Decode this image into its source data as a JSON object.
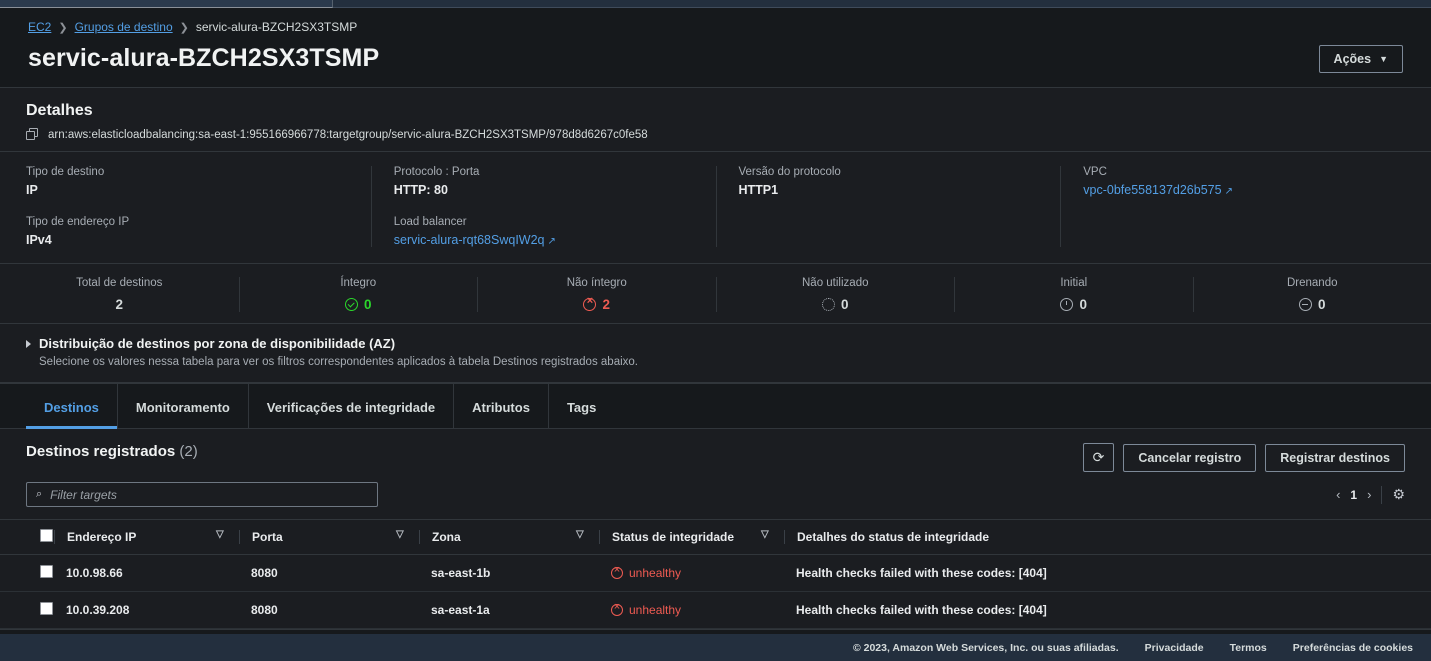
{
  "breadcrumb": {
    "items": [
      {
        "label": "EC2",
        "link": true
      },
      {
        "label": "Grupos de destino",
        "link": true
      },
      {
        "label": "servic-alura-BZCH2SX3TSMP",
        "link": false
      }
    ],
    "separator": "❯"
  },
  "header": {
    "title": "servic-alura-BZCH2SX3TSMP",
    "actions_label": "Ações",
    "actions_caret": "▼"
  },
  "details": {
    "heading": "Detalhes",
    "arn": "arn:aws:elasticloadbalancing:sa-east-1:955166966778:targetgroup/servic-alura-BZCH2SX3TSMP/978d8d6267c0fe58",
    "copy_icon": "copy-icon",
    "fields": {
      "target_type_label": "Tipo de destino",
      "target_type_value": "IP",
      "ip_address_type_label": "Tipo de endereço IP",
      "ip_address_type_value": "IPv4",
      "protocol_port_label": "Protocolo : Porta",
      "protocol_port_value": "HTTP: 80",
      "load_balancer_label": "Load balancer",
      "load_balancer_value": "servic-alura-rqt68SwqIW2q",
      "protocol_version_label": "Versão do protocolo",
      "protocol_version_value": "HTTP1",
      "vpc_label": "VPC",
      "vpc_value": "vpc-0bfe558137d26b575",
      "external_icon": "↗"
    }
  },
  "stats": [
    {
      "label": "Total de destinos",
      "value": "2",
      "icon": "none",
      "tone": "gray"
    },
    {
      "label": "Íntegro",
      "value": "0",
      "icon": "check-circle-icon",
      "tone": "green"
    },
    {
      "label": "Não íntegro",
      "value": "2",
      "icon": "x-circle-icon",
      "tone": "red"
    },
    {
      "label": "Não utilizado",
      "value": "0",
      "icon": "dotted-circle-icon",
      "tone": "gray"
    },
    {
      "label": "Initial",
      "value": "0",
      "icon": "clock-circle-icon",
      "tone": "gray"
    },
    {
      "label": "Drenando",
      "value": "0",
      "icon": "minus-circle-icon",
      "tone": "gray"
    }
  ],
  "az_section": {
    "title": "Distribuição de destinos por zona de disponibilidade (AZ)",
    "subtitle": "Selecione os valores nessa tabela para ver os filtros correspondentes aplicados à tabela Destinos registrados abaixo.",
    "expanded": false
  },
  "tabs": [
    {
      "label": "Destinos",
      "active": true
    },
    {
      "label": "Monitoramento",
      "active": false
    },
    {
      "label": "Verificações de integridade",
      "active": false
    },
    {
      "label": "Atributos",
      "active": false
    },
    {
      "label": "Tags",
      "active": false
    }
  ],
  "table_card": {
    "title": "Destinos registrados",
    "count": "(2)",
    "refresh_icon": "⟳",
    "deregister_label": "Cancelar registro",
    "register_label": "Registrar destinos",
    "search_placeholder": "Filter targets",
    "search_value": "",
    "search_icon": "⌕",
    "pagination": {
      "prev": "‹",
      "page": "1",
      "next": "›"
    },
    "settings_icon": "⚙",
    "columns": [
      "Endereço IP",
      "Porta",
      "Zona",
      "Status de integridade",
      "Detalhes do status de integridade"
    ],
    "rows": [
      {
        "ip": "10.0.98.66",
        "port": "8080",
        "zone": "sa-east-1b",
        "status": "unhealthy",
        "details": "Health checks failed with these codes: [404]"
      },
      {
        "ip": "10.0.39.208",
        "port": "8080",
        "zone": "sa-east-1a",
        "status": "unhealthy",
        "details": "Health checks failed with these codes: [404]"
      }
    ]
  },
  "footer": {
    "copyright": "© 2023, Amazon Web Services, Inc. ou suas afiliadas.",
    "privacy": "Privacidade",
    "terms": "Termos",
    "cookies": "Preferências de cookies"
  },
  "colors": {
    "accent_link": "#539fe5",
    "healthy": "#2bd62b",
    "unhealthy": "#ef5b52",
    "panel_bg": "#1b1d21",
    "page_bg": "#16191c",
    "footer_bg": "#232f3e"
  }
}
